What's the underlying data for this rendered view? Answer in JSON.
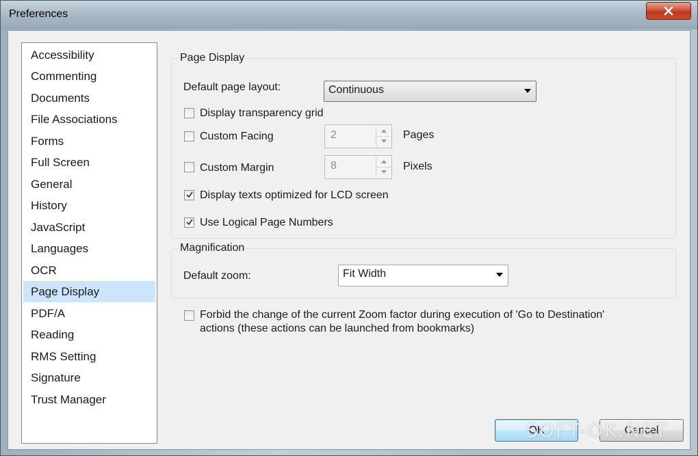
{
  "window": {
    "title": "Preferences"
  },
  "sidebar": {
    "items": [
      {
        "label": "Accessibility"
      },
      {
        "label": "Commenting"
      },
      {
        "label": "Documents"
      },
      {
        "label": "File Associations"
      },
      {
        "label": "Forms"
      },
      {
        "label": "Full Screen"
      },
      {
        "label": "General"
      },
      {
        "label": "History"
      },
      {
        "label": "JavaScript"
      },
      {
        "label": "Languages"
      },
      {
        "label": "OCR"
      },
      {
        "label": "Page Display"
      },
      {
        "label": "PDF/A"
      },
      {
        "label": "Reading"
      },
      {
        "label": "RMS Setting"
      },
      {
        "label": "Signature"
      },
      {
        "label": "Trust Manager"
      }
    ],
    "selected": "Page Display"
  },
  "page_display": {
    "group_title": "Page Display",
    "default_layout_label": "Default page layout:",
    "default_layout_value": "Continuous",
    "transparency_grid": {
      "label": "Display transparency grid",
      "checked": false
    },
    "custom_facing": {
      "label": "Custom Facing",
      "checked": false,
      "value": "2",
      "unit": "Pages"
    },
    "custom_margin": {
      "label": "Custom Margin",
      "checked": false,
      "value": "8",
      "unit": "Pixels"
    },
    "lcd_texts": {
      "label": "Display texts optimized for LCD screen",
      "checked": true
    },
    "logical_numbers": {
      "label": "Use Logical Page Numbers",
      "checked": true
    }
  },
  "magnification": {
    "group_title": "Magnification",
    "default_zoom_label": "Default zoom:",
    "default_zoom_value": "Fit Width"
  },
  "forbid_zoom": {
    "line1": "Forbid the change of the current Zoom factor during execution of  'Go to Destination'",
    "line2": "actions (these actions can be launched from bookmarks)",
    "checked": false
  },
  "buttons": {
    "ok": "OK",
    "cancel": "Cancel"
  },
  "watermark": "SOFT-OK.NET"
}
